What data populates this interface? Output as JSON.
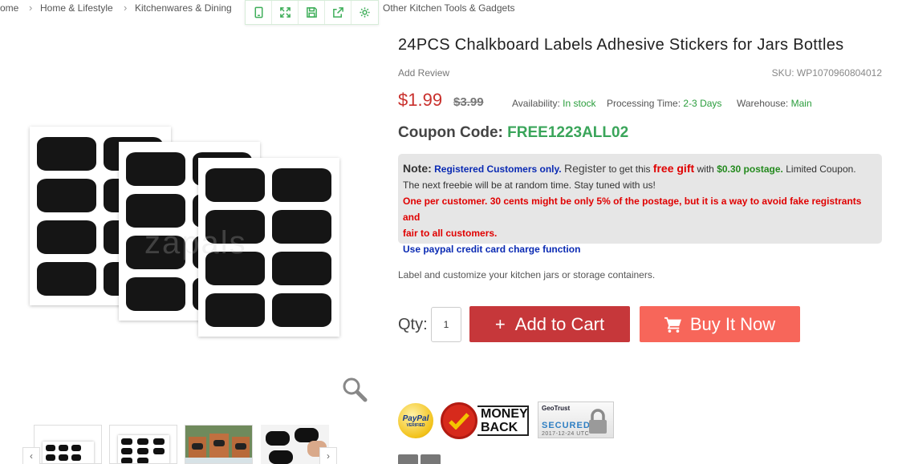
{
  "breadcrumb": {
    "items": [
      "ome",
      "Home & Lifestyle",
      "Kitchenwares & Dining",
      "Other Kitchen Tools & Gadgets"
    ]
  },
  "toolbar": {
    "icons": [
      "tablet-icon",
      "expand-icon",
      "save-icon",
      "share-icon",
      "settings-icon"
    ]
  },
  "product": {
    "title": "24PCS Chalkboard Labels Adhesive Stickers for Jars Bottles",
    "add_review": "Add Review",
    "sku": "SKU: WP1070960804012",
    "price": "$1.99",
    "old_price": "$3.99",
    "availability_label": "Availability:",
    "availability_value": "In stock",
    "processing_label": "Processing Time:",
    "processing_value": "2-3 Days",
    "warehouse_label": "Warehouse:",
    "warehouse_value": "Main",
    "coupon_label": "Coupon Code:",
    "coupon_code": "FREE1223ALL02",
    "description": "Label and customize your kitchen jars or storage containers.",
    "image_watermark": "zapals"
  },
  "note": {
    "label": "Note:",
    "registered": "Registered Customers only.",
    "register": "Register",
    "to_get": "to get this",
    "free_gift": "free gift",
    "with": "with",
    "postage": "$0.30 postage.",
    "limited": "Limited Coupon.",
    "line2": "The next freebie will be at random time. Stay tuned with us!",
    "line3": "One per customer. 30 cents might be only 5% of the postage, but it is a way to avoid fake registrants and",
    "line4": "fair to all customers.",
    "line5": "Use paypal credit card charge function"
  },
  "purchase": {
    "qty_label": "Qty:",
    "qty_value": "1",
    "add_to_cart": "Add to Cart",
    "add_to_cart_plus": "+",
    "buy_now": "Buy It Now"
  },
  "badges": {
    "paypal": "PayPal",
    "paypal_sub": "VERIFIED",
    "money_back_line1": "MONEY",
    "money_back_line2": "BACK",
    "geotrust": "GeoTrust",
    "secured": "SECURED",
    "geotrust_date": "2017-12-24 UTC"
  },
  "thumbnails": {
    "prev": "‹",
    "next": "›"
  },
  "colors": {
    "price": "#c9302c",
    "in_stock": "#2a9d3c",
    "coupon": "#3aa55a",
    "add_to_cart": "#c6373a",
    "buy_now": "#f7665a"
  }
}
